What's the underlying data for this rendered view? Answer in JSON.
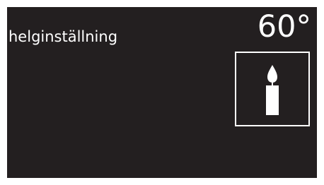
{
  "display": {
    "mode_label": "helginställning",
    "temperature": "60°",
    "mode_icon": "candle-icon",
    "colors": {
      "background": "#231f20",
      "foreground": "#ffffff",
      "bezel": "#ffffff"
    }
  }
}
